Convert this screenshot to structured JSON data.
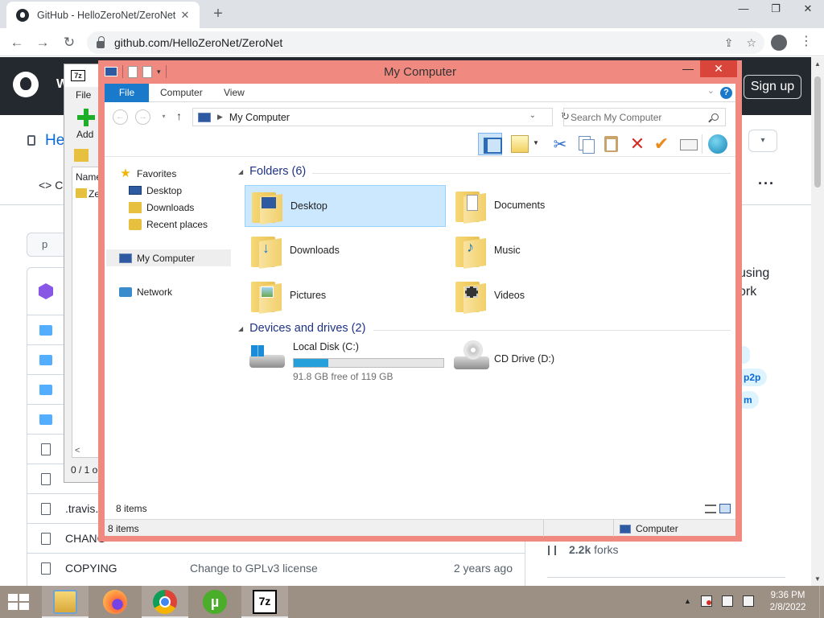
{
  "browser": {
    "tab_title": "GitHub - HelloZeroNet/ZeroNet",
    "tab_close": "✕",
    "new_tab": "+",
    "url": "github.com/HelloZeroNet/ZeroNet",
    "window_controls": [
      "—",
      "❐",
      "✕"
    ]
  },
  "github": {
    "header_partial": "W",
    "sign_up": "Sign up",
    "repo_partial": "He",
    "code_tab_partial": "<> C",
    "more_dots": "···",
    "branch_partial": "p",
    "about_line1": "using",
    "about_line2": "ork",
    "topics": [
      "p2p",
      "m"
    ],
    "files": [
      {
        "name": ".travis.y",
        "message": "",
        "age": ""
      },
      {
        "name": "CHANG",
        "message": "",
        "age": ""
      },
      {
        "name": "COPYING",
        "message": "Change to GPLv3 license",
        "age": "2 years ago"
      }
    ],
    "forks": "2.2k",
    "forks_label": "forks"
  },
  "zip": {
    "logo": "7z",
    "menu_file": "File",
    "add_label": "Add",
    "col_name": "Name",
    "item_partial": "Ze",
    "status": "0 / 1 o",
    "scroll_left": "<"
  },
  "explorer": {
    "title": "My Computer",
    "ribbon_tabs": [
      "File",
      "Computer",
      "View"
    ],
    "help": "?",
    "address": "My Computer",
    "search_placeholder": "Search My Computer",
    "nav": {
      "favorites": "Favorites",
      "desktop": "Desktop",
      "downloads": "Downloads",
      "recent": "Recent places",
      "my_computer": "My Computer",
      "network": "Network"
    },
    "folders_header": "Folders (6)",
    "folders": [
      "Desktop",
      "Documents",
      "Downloads",
      "Music",
      "Pictures",
      "Videos"
    ],
    "devices_header": "Devices and drives (2)",
    "drives": [
      {
        "name": "Local Disk (C:)",
        "free": "91.8 GB free of 119 GB",
        "used_fraction": 0.23
      },
      {
        "name": "CD Drive (D:)"
      }
    ],
    "items_count": "8 items",
    "status_items": "8 items",
    "status_location": "Computer"
  },
  "taskbar": {
    "apps": [
      "File Explorer",
      "Firefox",
      "Chrome",
      "uTorrent",
      "7-Zip"
    ],
    "ut_letter": "µ",
    "sevenzip_label": "7z",
    "time": "9:36 PM",
    "date": "2/8/2022",
    "tray_arrow": "▲"
  }
}
